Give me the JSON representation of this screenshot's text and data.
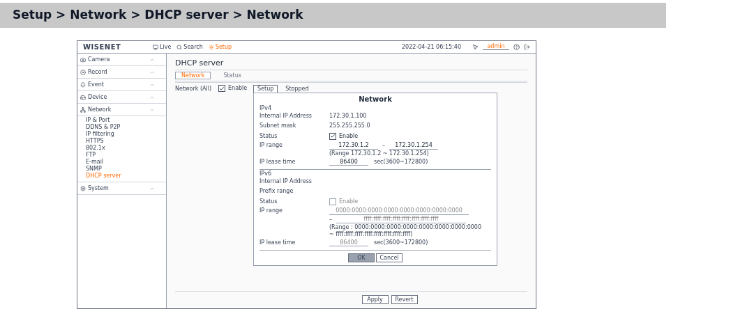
{
  "header": {
    "breadcrumb": "Setup > Network > DHCP server > Network"
  },
  "topbar": {
    "logo": "WISENET",
    "nav": [
      {
        "label": "Live",
        "selected": false
      },
      {
        "label": "Search",
        "selected": false
      },
      {
        "label": "Setup",
        "selected": true
      }
    ],
    "datetime": "2022-04-21 06:15:40",
    "user": "admin"
  },
  "sidebar": {
    "items": [
      {
        "label": "Camera",
        "expanded": false
      },
      {
        "label": "Record",
        "expanded": false
      },
      {
        "label": "Event",
        "expanded": false
      },
      {
        "label": "Device",
        "expanded": false
      },
      {
        "label": "Network",
        "expanded": true,
        "children": [
          {
            "label": "IP & Port",
            "selected": false
          },
          {
            "label": "DDNS & P2P",
            "selected": false
          },
          {
            "label": "IP filtering",
            "selected": false
          },
          {
            "label": "HTTPS",
            "selected": false
          },
          {
            "label": "802.1x",
            "selected": false
          },
          {
            "label": "FTP",
            "selected": false
          },
          {
            "label": "E-mail",
            "selected": false
          },
          {
            "label": "SNMP",
            "selected": false
          },
          {
            "label": "DHCP server",
            "selected": true
          }
        ]
      },
      {
        "label": "System",
        "expanded": false
      }
    ]
  },
  "page": {
    "title": "DHCP server",
    "tabs": [
      {
        "label": "Network",
        "selected": true
      },
      {
        "label": "Status",
        "selected": false
      }
    ],
    "network_label": "Network (All)",
    "enable": {
      "label": "Enable",
      "checked": true
    },
    "subtabs": [
      {
        "label": "Setup",
        "selected": true
      },
      {
        "label": "Stopped",
        "selected": false
      }
    ]
  },
  "dialog": {
    "title": "Network",
    "sections": [
      {
        "heading": "IPv4",
        "rows": [
          {
            "kind": "text",
            "label": "Internal IP Address",
            "value": "172.30.1.100"
          },
          {
            "kind": "text",
            "label": "Subnet mask",
            "value": "255.255.255.0"
          },
          {
            "kind": "checkbox",
            "label": "Status",
            "option": "Enable",
            "checked": true,
            "disabled": false
          },
          {
            "kind": "range",
            "label": "IP range",
            "from": "172.30.1.2",
            "separator": "–",
            "to": "172.30.1.254",
            "stacked": false,
            "disabled": false,
            "notes": [
              "(Range 172.30.1.2 ~ 172.30.1.254)"
            ]
          },
          {
            "kind": "lease",
            "label": "IP lease time",
            "value": "86400",
            "unit": "sec(3600~172800)",
            "disabled": false
          }
        ]
      },
      {
        "heading": "IPv6",
        "rows": [
          {
            "kind": "text",
            "label": "Internal IP Address"
          },
          {
            "kind": "text",
            "label": "Prefix range"
          },
          {
            "kind": "checkbox",
            "label": "Status",
            "option": "Enable",
            "checked": false,
            "disabled": true
          },
          {
            "kind": "range",
            "label": "IP range",
            "from": "0000:0000:0000:0000:0000:0000:0000:0000",
            "separator": "–",
            "to": "ffff:ffff:ffff:ffff:ffff:ffff:ffff:ffff",
            "stacked": true,
            "disabled": true,
            "notes": [
              "(Range : 0000:0000:0000:0000:0000:0000:0000:0000",
              "~ ffff:ffff:ffff:ffff:ffff:ffff:ffff:ffff)"
            ]
          },
          {
            "kind": "lease",
            "label": "IP lease time",
            "value": "86400",
            "unit": "sec(3600~172800)",
            "disabled": true
          }
        ]
      }
    ],
    "buttons": [
      {
        "label": "OK",
        "primary": true
      },
      {
        "label": "Cancel",
        "primary": false
      }
    ]
  },
  "footer": {
    "buttons": [
      "Apply",
      "Revert"
    ]
  }
}
